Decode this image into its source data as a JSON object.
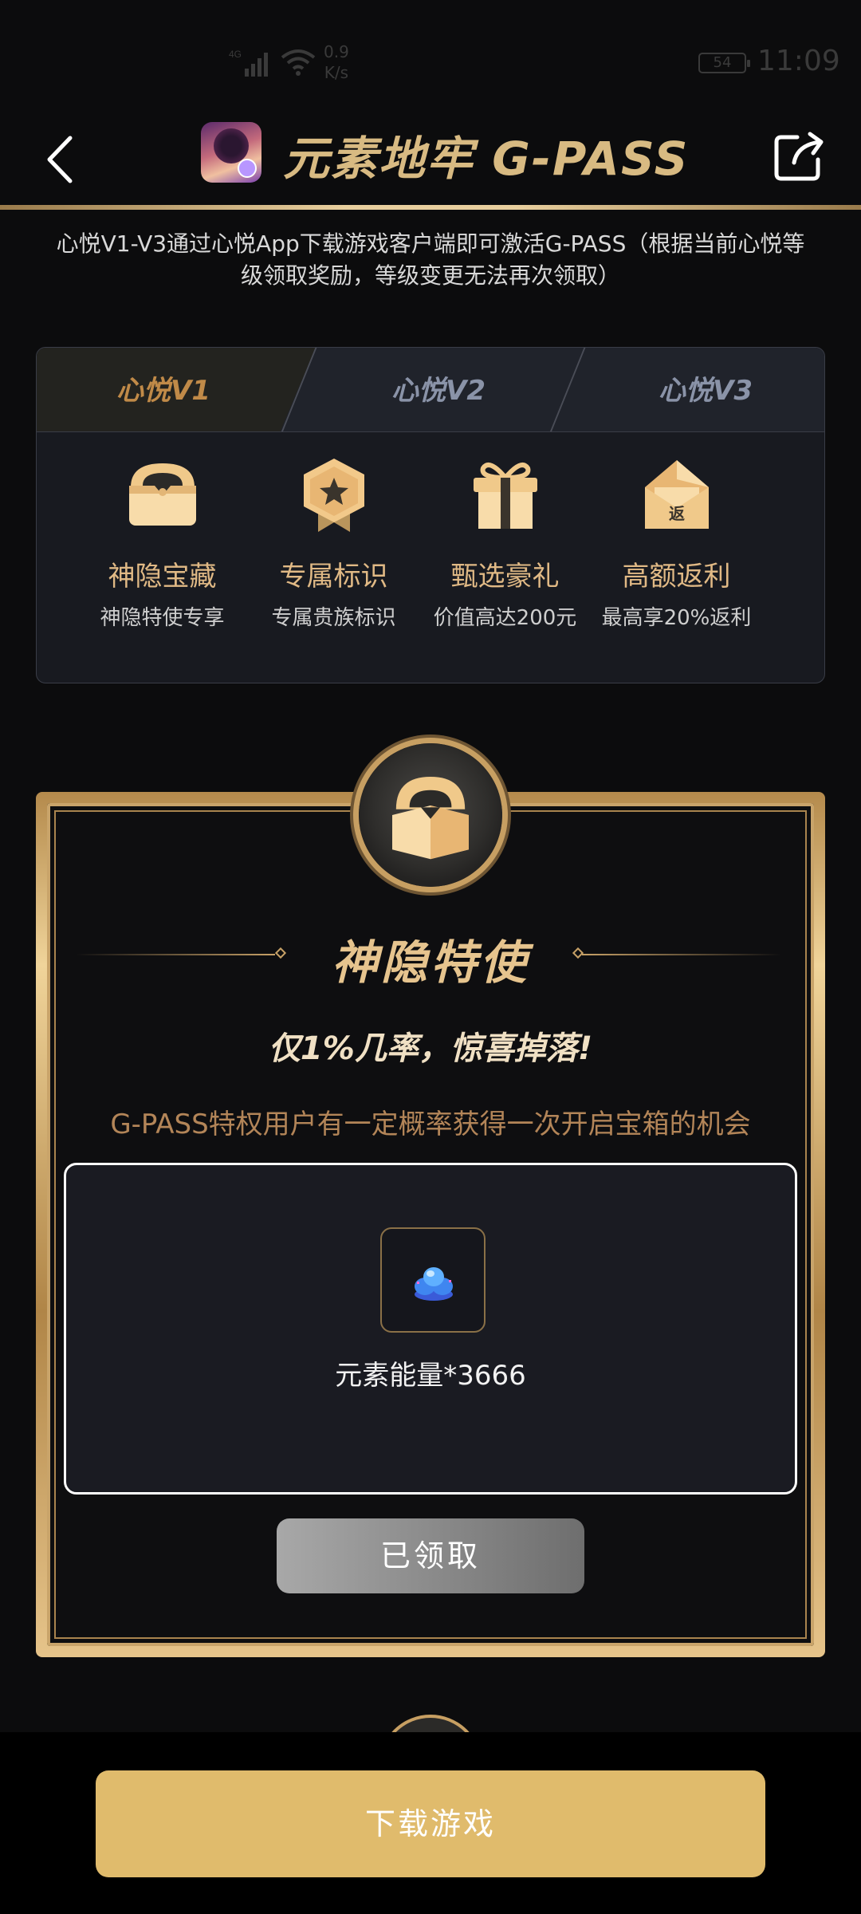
{
  "status_bar": {
    "network_type": "4G",
    "speed_value": "0.9",
    "speed_unit": "K/s",
    "battery": "54",
    "time": "11:09"
  },
  "header": {
    "title": "元素地牢 G-PASS",
    "back_icon": "chevron-left-icon",
    "share_icon": "share-icon"
  },
  "notice": "心悦V1-V3通过心悦App下载游戏客户端即可激活G-PASS（根据当前心悦等级领取奖励，等级变更无法再次领取）",
  "tabs": [
    {
      "label": "心悦V1",
      "active": true
    },
    {
      "label": "心悦V2",
      "active": false
    },
    {
      "label": "心悦V3",
      "active": false
    }
  ],
  "benefits": [
    {
      "name": "神隐宝藏",
      "desc": "神隐特使专享",
      "icon": "treasure-chest-icon"
    },
    {
      "name": "专属标识",
      "desc": "专属贵族标识",
      "icon": "star-badge-icon"
    },
    {
      "name": "甄选豪礼",
      "desc": "价值高达200元",
      "icon": "gift-box-icon"
    },
    {
      "name": "高额返利",
      "desc": "最高享20%返利",
      "icon": "rebate-envelope-icon"
    }
  ],
  "rebate_icon_text": "返",
  "reward": {
    "title": "神隐特使",
    "tagline": "仅1%几率，惊喜掉落!",
    "description": "G-PASS特权用户有一定概率获得一次开启宝箱的机会",
    "prize_name": "元素能量*3666",
    "prize_icon": "energy-crystal-icon",
    "claim_button": "已领取"
  },
  "download_button": "下载游戏",
  "colors": {
    "gold": "#d8ba82",
    "button_gold": "#e0bb6c",
    "background": "#0c0c0d"
  }
}
